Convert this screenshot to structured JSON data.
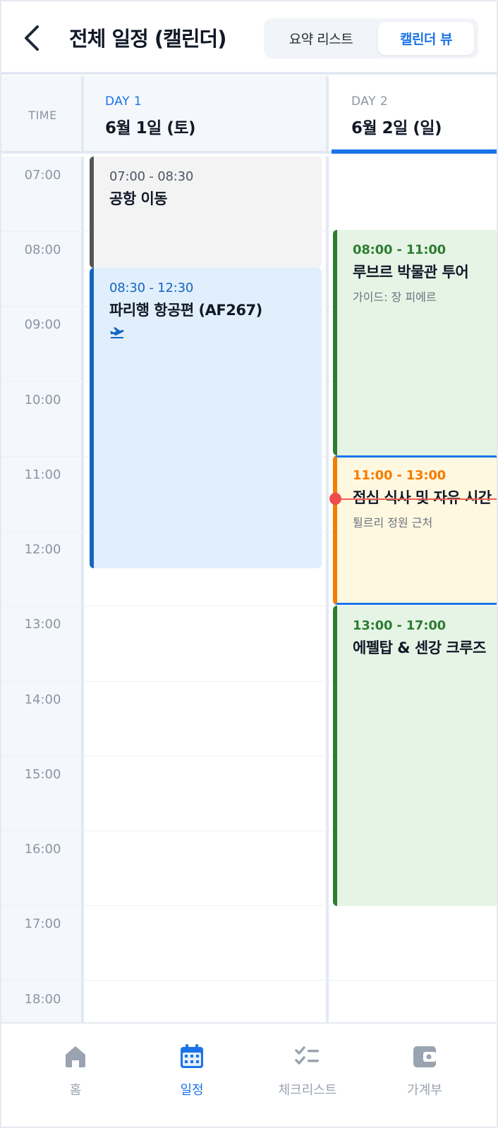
{
  "header": {
    "title": "전체 일정 (캘린더)",
    "segments": [
      "요약 리스트",
      "캘린더 뷰"
    ],
    "active_segment": "캘린더 뷰"
  },
  "columns": {
    "time_header": "TIME",
    "days": [
      {
        "label": "DAY 1",
        "date": "6월 1일 (토)",
        "active": false
      },
      {
        "label": "DAY 2",
        "date": "6월 2일 (일)",
        "active": true
      }
    ]
  },
  "time_labels": [
    "07:00",
    "08:00",
    "09:00",
    "10:00",
    "11:00",
    "12:00",
    "13:00",
    "14:00",
    "15:00",
    "16:00",
    "17:00",
    "18:00"
  ],
  "events": {
    "day1": [
      {
        "time": "07:00 - 08:30",
        "title": "공항 이동",
        "subtitle": "",
        "icon": "",
        "color": "#555555",
        "bg": "#f3f3f3"
      },
      {
        "time": "08:30 - 12:30",
        "title": "파리행 항공편 (AF267)",
        "subtitle": "",
        "icon": "airplane-takeoff-icon",
        "color": "#1565c0",
        "bg": "#e1eefc"
      }
    ],
    "day2": [
      {
        "time": "08:00 - 11:00",
        "title": "루브르 박물관 투어",
        "subtitle": "가이드: 장 피에르",
        "color": "#2e7d32",
        "bg": "#e6f4e6"
      },
      {
        "time": "11:00 - 13:00",
        "title": "점심 식사 및 자유 시간",
        "subtitle": "튈르리 정원 근처",
        "color": "#f57c00",
        "bg": "#fff8e1",
        "selected": true
      },
      {
        "time": "13:00 - 17:00",
        "title": "에펠탑 & 센강 크루즈",
        "subtitle": "",
        "color": "#2e7d32",
        "bg": "#e6f4e6"
      }
    ]
  },
  "bottom_nav": [
    {
      "label": "홈",
      "icon": "home-icon",
      "active": false
    },
    {
      "label": "일정",
      "icon": "calendar-icon",
      "active": true
    },
    {
      "label": "체크리스트",
      "icon": "checklist-icon",
      "active": false
    },
    {
      "label": "가계부",
      "icon": "wallet-icon",
      "active": false
    }
  ],
  "colors": {
    "accent": "#1a73e8",
    "now_indicator": "#ee4c4c"
  }
}
